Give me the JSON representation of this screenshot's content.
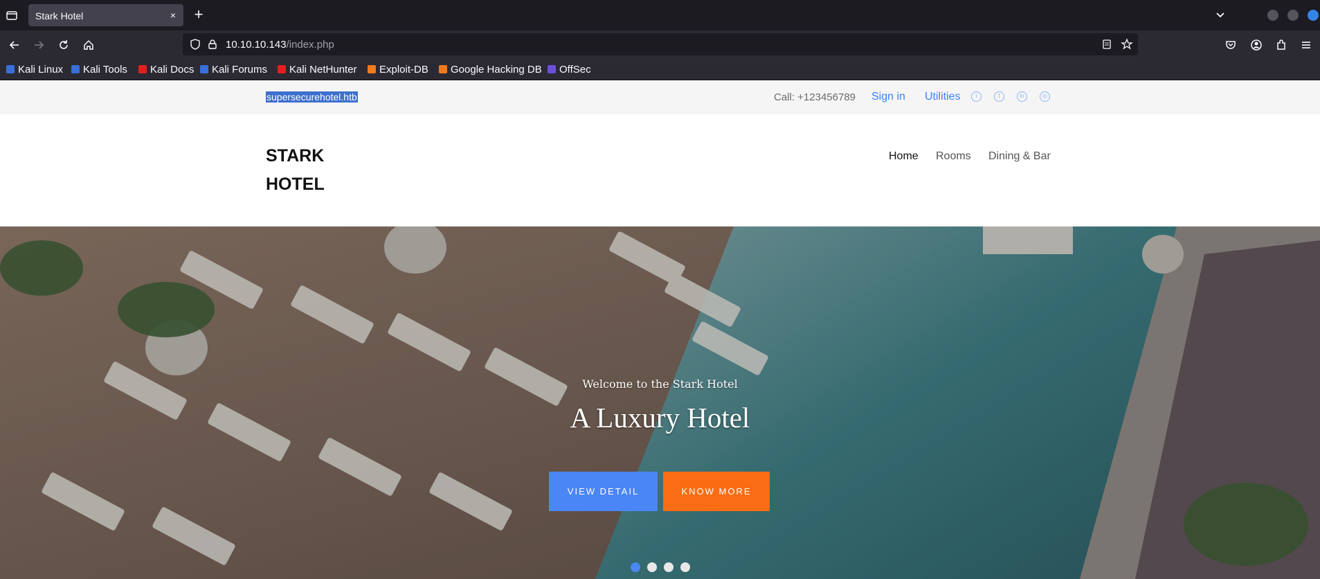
{
  "browser": {
    "tab_title": "Stark Hotel",
    "tab_close": "×",
    "new_tab": "+",
    "url_host": "10.10.10.143",
    "url_path": "/index.php",
    "bookmarks": [
      {
        "label": "Kali Linux",
        "color": "#3a6fd9"
      },
      {
        "label": "Kali Tools",
        "color": "#3a6fd9"
      },
      {
        "label": "Kali Docs",
        "color": "#e02020"
      },
      {
        "label": "Kali Forums",
        "color": "#3a6fd9"
      },
      {
        "label": "Kali NetHunter",
        "color": "#e02020"
      },
      {
        "label": "Exploit-DB",
        "color": "#f07a1e"
      },
      {
        "label": "Google Hacking DB",
        "color": "#f07a1e"
      },
      {
        "label": "OffSec",
        "color": "#6c4fd6"
      }
    ]
  },
  "topbar": {
    "domain": "supersecurehotel.htb",
    "call": "Call: +123456789",
    "signin": "Sign in",
    "utilities": "Utilities",
    "social_icons": [
      "twitter-icon",
      "facebook-icon",
      "linkedin-icon",
      "instagram-icon"
    ]
  },
  "header": {
    "logo_line1": "STARK",
    "logo_line2": "HOTEL",
    "nav": [
      "Home",
      "Rooms",
      "Dining & Bar"
    ]
  },
  "hero": {
    "welcome": "Welcome to the Stark Hotel",
    "headline": "A Luxury Hotel",
    "view_detail": "VIEW DETAIL",
    "know_more": "KNOW MORE",
    "slides": 4,
    "active_slide": 1
  },
  "colors": {
    "accent_blue": "#4a86f5",
    "accent_orange": "#fa6d14"
  }
}
